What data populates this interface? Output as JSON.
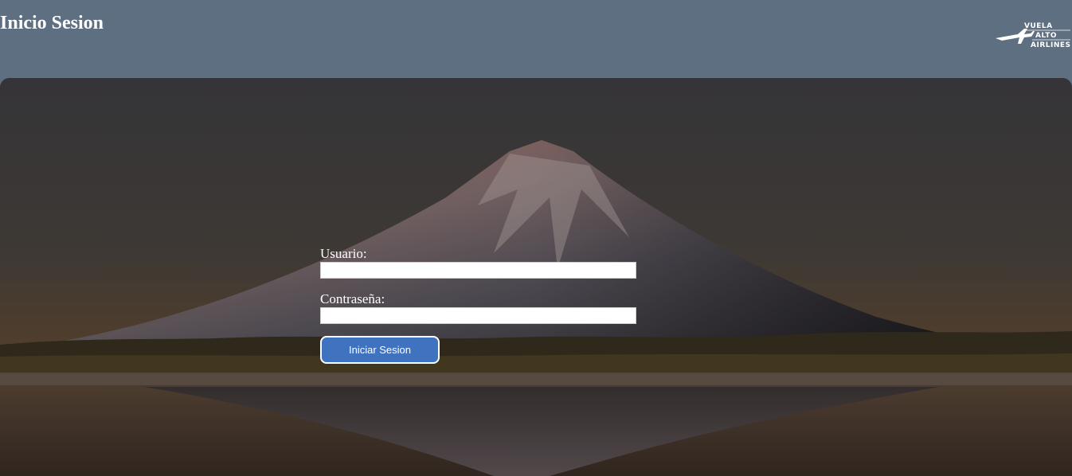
{
  "header": {
    "title": "Inicio Sesion",
    "logo": {
      "icon": "airplane-icon",
      "lines": [
        "VUELA",
        "ALTO",
        "AIRLINES"
      ]
    }
  },
  "login": {
    "username_label": "Usuario:",
    "username_value": "",
    "password_label": "Contraseña:",
    "password_value": "",
    "submit_label": "Iniciar Sesion"
  },
  "colors": {
    "header_bg": "#5f6f82",
    "button_bg": "#3f73c0",
    "text": "#ffffff"
  }
}
